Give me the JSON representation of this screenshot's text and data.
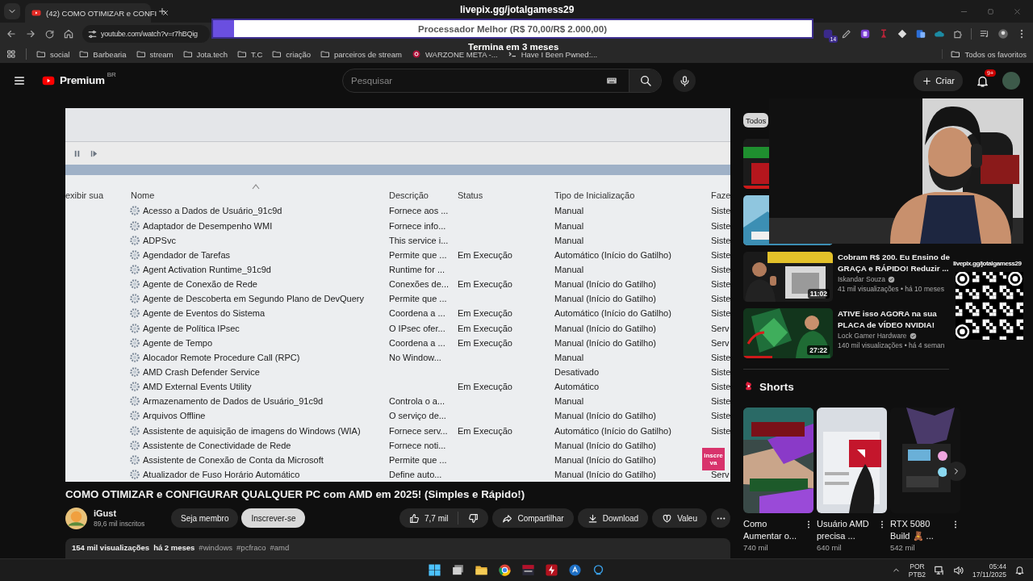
{
  "browser": {
    "tab_title": "(42) COMO OTIMIZAR e CONFI",
    "url": "youtube.com/watch?v=r7hBQig",
    "extension_badge": "14",
    "bookmarks": [
      {
        "label": "social",
        "kind": "folder"
      },
      {
        "label": "Barbearia",
        "kind": "folder"
      },
      {
        "label": "stream",
        "kind": "folder"
      },
      {
        "label": "Jota.tech",
        "kind": "folder"
      },
      {
        "label": "T.C",
        "kind": "folder"
      },
      {
        "label": "criação",
        "kind": "folder"
      },
      {
        "label": "parceiros de stream",
        "kind": "folder"
      },
      {
        "label": "WARZONE META -...",
        "kind": "target"
      },
      {
        "label": "Have I Been Pwned:...",
        "kind": "code"
      }
    ],
    "all_bookmarks": "Todos os favoritos"
  },
  "stream_overlay": {
    "link": "livepix.gg/jotalgamess29",
    "goal": {
      "label": "Processador Melhor (R$ 70,00/R$ 2.000,00)",
      "level": 0.035
    },
    "ends": "Termina em 3 meses",
    "qr_label": "livepix.gg/jotalgamess29"
  },
  "youtube_header": {
    "logo": "Premium",
    "region": "BR",
    "search_placeholder": "Pesquisar",
    "create": "Criar",
    "notifications": "9+"
  },
  "video_frame": {
    "side_text": "exibir sua",
    "columns": [
      "Nome",
      "Descrição",
      "Status",
      "Tipo de Inicialização",
      "Faze"
    ],
    "rows": [
      {
        "name": "Acesso a Dados de Usuário_91c9d",
        "description": "Fornece aos ...",
        "startup": "Manual",
        "column_5": "Siste"
      },
      {
        "name": "Adaptador de Desempenho WMI",
        "description": "Fornece info...",
        "startup": "Manual",
        "column_5": "Siste"
      },
      {
        "name": "ADPSvc",
        "description": "This service i...",
        "startup": "Manual",
        "column_5": "Siste"
      },
      {
        "name": "Agendador de Tarefas",
        "description": "Permite que ...",
        "status": "Em Execução",
        "startup": "Automático (Início do Gatilho)",
        "column_5": "Siste"
      },
      {
        "name": "Agent Activation Runtime_91c9d",
        "description": "Runtime for ...",
        "startup": "Manual",
        "column_5": "Siste"
      },
      {
        "name": "Agente de Conexão de Rede",
        "description": "Conexões de...",
        "status": "Em Execução",
        "startup": "Manual (Início do Gatilho)",
        "column_5": "Siste"
      },
      {
        "name": "Agente de Descoberta em Segundo Plano de DevQuery",
        "description": "Permite que ...",
        "startup": "Manual (Início do Gatilho)",
        "column_5": "Siste"
      },
      {
        "name": "Agente de Eventos do Sistema",
        "description": "Coordena a ...",
        "status": "Em Execução",
        "startup": "Automático (Início do Gatilho)",
        "column_5": "Siste"
      },
      {
        "name": "Agente de Política IPsec",
        "description": "O IPsec ofer...",
        "status": "Em Execução",
        "startup": "Manual (Início do Gatilho)",
        "column_5": "Serv"
      },
      {
        "name": "Agente de Tempo",
        "description": "Coordena a ...",
        "status": "Em Execução",
        "startup": "Manual (Início do Gatilho)",
        "column_5": "Serv"
      },
      {
        "name": "Alocador Remote Procedure Call (RPC)",
        "description": "No Window...",
        "startup": "Manual",
        "column_5": "Siste"
      },
      {
        "name": "AMD Crash Defender Service",
        "startup": "Desativado",
        "column_5": "Siste"
      },
      {
        "name": "AMD External Events Utility",
        "status": "Em Execução",
        "startup": "Automático",
        "column_5": "Siste"
      },
      {
        "name": "Armazenamento de Dados de Usuário_91c9d",
        "description": "Controla o a...",
        "startup": "Manual",
        "column_5": "Siste"
      },
      {
        "name": "Arquivos Offline",
        "description": "O serviço de...",
        "startup": "Manual (Início do Gatilho)",
        "column_5": "Siste"
      },
      {
        "name": "Assistente de aquisição de imagens do Windows (WIA)",
        "description": "Fornece serv...",
        "status": "Em Execução",
        "startup": "Automático (Início do Gatilho)",
        "column_5": "Siste"
      },
      {
        "name": "Assistente de Conectividade de Rede",
        "description": "Fornece noti...",
        "startup": "Manual (Início do Gatilho)"
      },
      {
        "name": "Assistente de Conexão de Conta da Microsoft",
        "description": "Permite que ...",
        "startup": "Manual (Início do Gatilho)"
      },
      {
        "name": "Atualizador de Fuso Horário Automático",
        "description": "Define auto...",
        "startup": "Manual (Início do Gatilho)",
        "column_5": "Serv"
      }
    ],
    "corner_badge": [
      "inscre",
      "va"
    ]
  },
  "video": {
    "title": "COMO OTIMIZAR e CONFIGURAR QUALQUER PC com AMD em 2025! (Simples e Rápido!)",
    "channel": "iGust",
    "subscribers": "89,6 mil inscritos",
    "join": "Seja membro",
    "subscribe": "Inscrever-se",
    "likes": "7,7 mil",
    "share": "Compartilhar",
    "download": "Download",
    "thanks": "Valeu",
    "views": "154 mil visualizações",
    "date": "há 2 meses",
    "hashtags": [
      "#windows",
      "#pcfraco",
      "#amd"
    ]
  },
  "sidebar": {
    "chip": "Todos",
    "videos": [
      {
        "kind": "picture"
      },
      {
        "kind": "picture"
      },
      {
        "kind": "video",
        "title": "Cobram R$ 200. Eu Ensino de GRAÇA e RÁPIDO! Reduzir ...",
        "channel": "Iskandar Souza",
        "verified": true,
        "meta": "41 mil visualizações • há 10 meses",
        "duration": "11:02"
      },
      {
        "kind": "video",
        "title": "ATIVE isso AGORA na sua PLACA de VÍDEO NVIDIA!",
        "channel": "Lock Gamer Hardware",
        "verified": true,
        "meta": "140 mil visualizações • há 4 seman",
        "duration": "27:22"
      }
    ],
    "shorts_title": "Shorts",
    "shorts": [
      {
        "title": "Como Aumentar o...",
        "views": "740 mil"
      },
      {
        "title": "Usuário AMD precisa ...",
        "views": "640 mil"
      },
      {
        "title": "RTX 5080 Build 🧸 ...",
        "views": "542 mil"
      }
    ]
  },
  "taskbar": {
    "language": "POR",
    "layout": "PTB2",
    "time": "05:44",
    "date": "17/11/2025"
  }
}
